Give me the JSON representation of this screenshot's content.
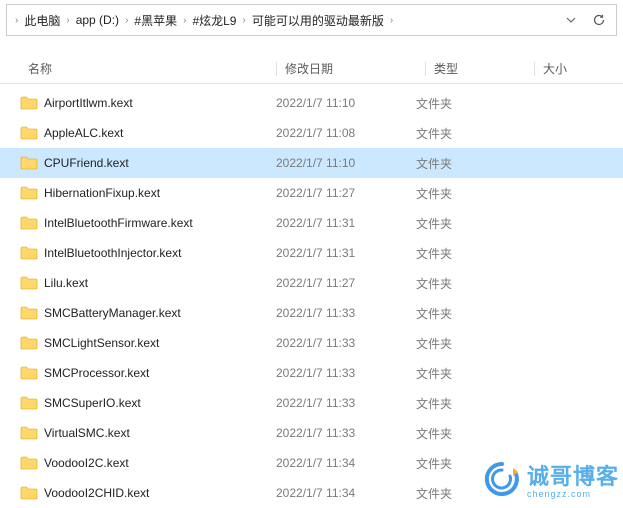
{
  "breadcrumbs": [
    "此电脑",
    "app (D:)",
    "#黑苹果",
    "#炫龙L9",
    "可能可以用的驱动最新版"
  ],
  "columns": {
    "name": "名称",
    "date": "修改日期",
    "type": "类型",
    "size": "大小"
  },
  "files": [
    {
      "name": "AirportItlwm.kext",
      "date": "2022/1/7 11:10",
      "type": "文件夹",
      "selected": false
    },
    {
      "name": "AppleALC.kext",
      "date": "2022/1/7 11:08",
      "type": "文件夹",
      "selected": false
    },
    {
      "name": "CPUFriend.kext",
      "date": "2022/1/7 11:10",
      "type": "文件夹",
      "selected": true
    },
    {
      "name": "HibernationFixup.kext",
      "date": "2022/1/7 11:27",
      "type": "文件夹",
      "selected": false
    },
    {
      "name": "IntelBluetoothFirmware.kext",
      "date": "2022/1/7 11:31",
      "type": "文件夹",
      "selected": false
    },
    {
      "name": "IntelBluetoothInjector.kext",
      "date": "2022/1/7 11:31",
      "type": "文件夹",
      "selected": false
    },
    {
      "name": "Lilu.kext",
      "date": "2022/1/7 11:27",
      "type": "文件夹",
      "selected": false
    },
    {
      "name": "SMCBatteryManager.kext",
      "date": "2022/1/7 11:33",
      "type": "文件夹",
      "selected": false
    },
    {
      "name": "SMCLightSensor.kext",
      "date": "2022/1/7 11:33",
      "type": "文件夹",
      "selected": false
    },
    {
      "name": "SMCProcessor.kext",
      "date": "2022/1/7 11:33",
      "type": "文件夹",
      "selected": false
    },
    {
      "name": "SMCSuperIO.kext",
      "date": "2022/1/7 11:33",
      "type": "文件夹",
      "selected": false
    },
    {
      "name": "VirtualSMC.kext",
      "date": "2022/1/7 11:33",
      "type": "文件夹",
      "selected": false
    },
    {
      "name": "VoodooI2C.kext",
      "date": "2022/1/7 11:34",
      "type": "文件夹",
      "selected": false
    },
    {
      "name": "VoodooI2CHID.kext",
      "date": "2022/1/7 11:34",
      "type": "文件夹",
      "selected": false
    }
  ],
  "watermark": {
    "text": "诚哥博客",
    "sub": "chengzz.com"
  }
}
